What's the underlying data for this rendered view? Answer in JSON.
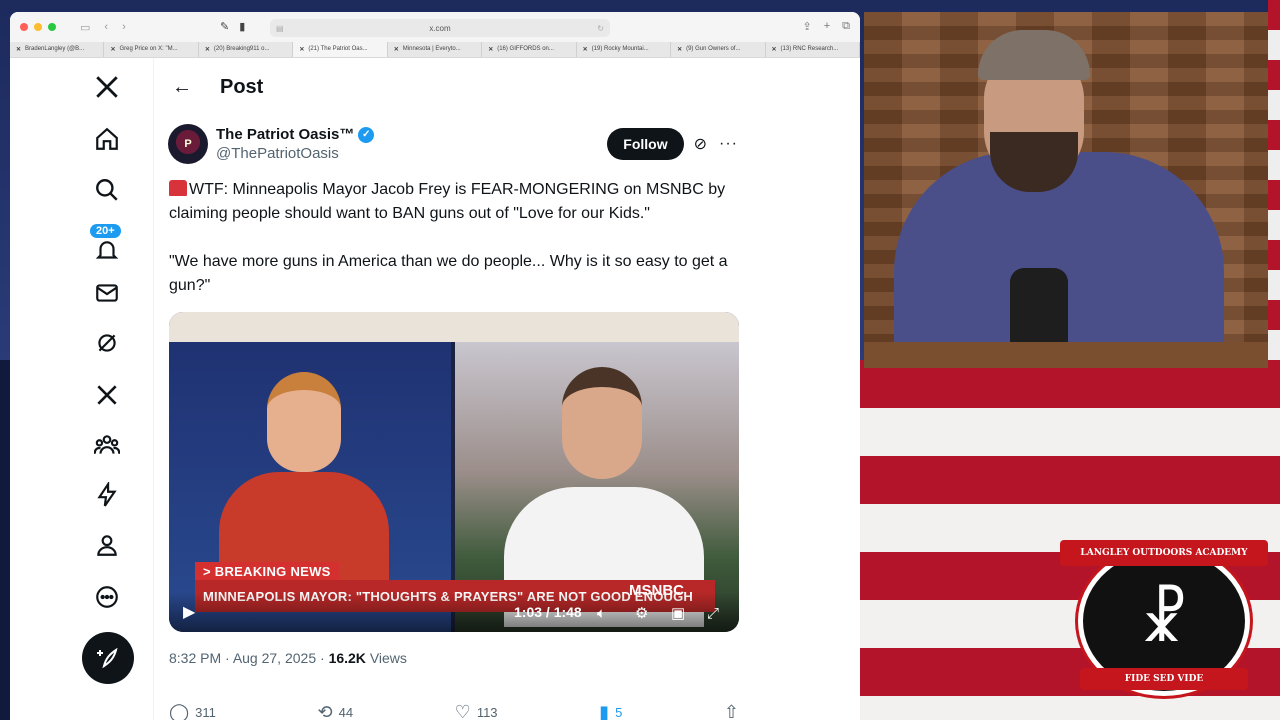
{
  "browser": {
    "url": "x.com",
    "tabs": [
      {
        "label": "BradenLangley (@B..."
      },
      {
        "label": "Greg Price on X: \"M..."
      },
      {
        "label": "(20) Breaking911 o..."
      },
      {
        "label": "(21) The Patriot Oas..."
      },
      {
        "label": "Minnesota | Everyto..."
      },
      {
        "label": "(16) GIFFORDS on..."
      },
      {
        "label": "(19) Rocky Mountai..."
      },
      {
        "label": "(9) Gun Owners of..."
      },
      {
        "label": "(13) RNC Research..."
      }
    ]
  },
  "nav": {
    "notifications_badge": "20+",
    "icons": [
      "x-logo-icon",
      "home-icon",
      "search-icon",
      "notifications-icon",
      "messages-icon",
      "grok-icon",
      "premium-x-icon",
      "communities-icon",
      "verified-orgs-icon",
      "profile-icon",
      "more-icon"
    ]
  },
  "post": {
    "header_title": "Post",
    "author_name": "The Patriot Oasis™",
    "author_handle": "@ThePatriotOasis",
    "avatar_text": "P",
    "follow_label": "Follow",
    "text_line1": "WTF: Minneapolis Mayor Jacob Frey is FEAR-MONGERING on MSNBC by claiming people should want to BAN guns out of \"Love for our Kids.\"",
    "text_line2": "\"We have more guns in America than we do people... Why is it so easy to get a gun?\"",
    "video": {
      "breaking": "> BREAKING NEWS",
      "chyron": "MINNEAPOLIS MAYOR: \"THOUGHTS & PRAYERS\" ARE NOT GOOD ENOUGH",
      "network": "MSNBC",
      "time": "1:03 / 1:48"
    },
    "time": "8:32 PM",
    "date": "Aug 27, 2025",
    "views_count": "16.2K",
    "views_label": "Views",
    "replies": "311",
    "reposts": "44",
    "likes": "113",
    "bookmarks": "5"
  },
  "logo": {
    "top_text": "LANGLEY OUTDOORS ACADEMY",
    "bottom_text": "FIDE SED VIDE"
  },
  "colors": {
    "accent": "#1d9bf0",
    "brand_dark": "#0f1419",
    "flag_red": "#b3142a"
  }
}
